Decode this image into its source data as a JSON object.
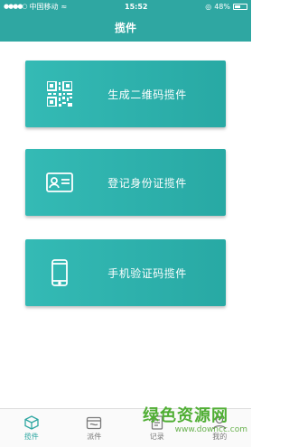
{
  "status_bar": {
    "carrier": "中国移动",
    "time": "15:52",
    "battery": "48%"
  },
  "nav": {
    "title": "揽件"
  },
  "cards": [
    {
      "label": "生成二维码揽件",
      "icon": "qr-code-icon"
    },
    {
      "label": "登记身份证揽件",
      "icon": "id-card-icon"
    },
    {
      "label": "手机验证码揽件",
      "icon": "mobile-phone-icon"
    }
  ],
  "tabs": [
    {
      "label": "揽件",
      "icon": "box-icon",
      "active": true
    },
    {
      "label": "派件",
      "icon": "wallet-icon",
      "active": false
    },
    {
      "label": "记录",
      "icon": "document-icon",
      "active": false
    },
    {
      "label": "我的",
      "icon": "person-icon",
      "active": false
    }
  ],
  "watermark": {
    "main": "绿色资源网",
    "url": "www.downcc.com"
  },
  "colors": {
    "primary": "#2fa7a2",
    "card_start": "#34bab5",
    "card_end": "#28a9a4"
  }
}
